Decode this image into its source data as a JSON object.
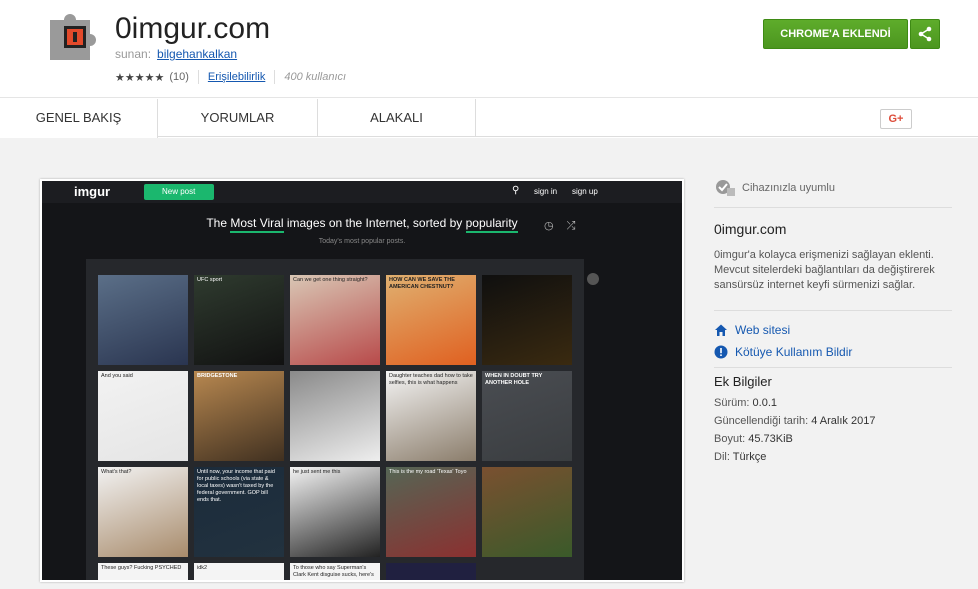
{
  "header": {
    "title": "0imgur.com",
    "offered_by_label": "sunan:",
    "offered_by_name": "bilgehankalkan",
    "stars": "★★★★★",
    "rating_count": "(10)",
    "accessibility_link": "Erişilebilirlik",
    "users": "400 kullanıcı",
    "add_button": "CHROME'A EKLENDİ"
  },
  "tabs": [
    "GENEL BAKIŞ",
    "YORUMLAR",
    "ALAKALI"
  ],
  "gplus_label": "G+",
  "screenshot": {
    "logo": "imgur",
    "new_post": "New post",
    "sign_in": "sign in",
    "sign_up": "sign up",
    "hero_the": "The",
    "hero_most_viral": "Most Viral",
    "hero_middle": "images on the Internet, sorted by",
    "hero_popularity": "popularity",
    "hero_sub": "Today's most popular posts.",
    "tiles": [
      {
        "caption": ""
      },
      {
        "caption": "UFC sport"
      },
      {
        "caption": "Can we get one thing straight?"
      },
      {
        "caption": "HOW CAN WE SAVE THE AMERICAN CHESTNUT?"
      },
      {
        "caption": ""
      },
      {
        "caption": "And you said"
      },
      {
        "caption": "BRIDGESTONE"
      },
      {
        "caption": ""
      },
      {
        "caption": "Daughter teaches dad how to take selfies, this is what happens"
      },
      {
        "caption": "WHEN IN DOUBT TRY ANOTHER HOLE"
      },
      {
        "caption": "What's that?"
      },
      {
        "caption": "Until now, your income that paid for public schools (via state & local taxes) wasn't taxed by the federal government. GOP bill ends that."
      },
      {
        "caption": "he just sent me this"
      },
      {
        "caption": "This is the my road 'Texas' Toyo"
      },
      {
        "caption": ""
      }
    ],
    "bottom_tiles": [
      "These guys? Fucking PSYCHED",
      "idk2",
      "To those who say Superman's Clark Kent disguise sucks, here's",
      ""
    ]
  },
  "sidebar": {
    "compat": "Cihazınızla uyumlu",
    "name": "0imgur.com",
    "description": "0imgur'a kolayca erişmenizi sağlayan eklenti. Mevcut sitelerdeki bağlantıları da değiştirerek sansürsüz internet keyfi sürmenizi sağlar.",
    "website": "Web sitesi",
    "report": "Kötüye Kullanım Bildir",
    "extra_heading": "Ek Bilgiler",
    "version_label": "Sürüm:",
    "version": "0.0.1",
    "updated_label": "Güncellendiği tarih:",
    "updated": "4 Aralık 2017",
    "size_label": "Boyut:",
    "size": "45.73KiB",
    "lang_label": "Dil:",
    "lang": "Türkçe"
  },
  "colors": {
    "accent_green": "#4c961f",
    "link_blue": "#1558b0",
    "imgur_green": "#1bb76e"
  }
}
